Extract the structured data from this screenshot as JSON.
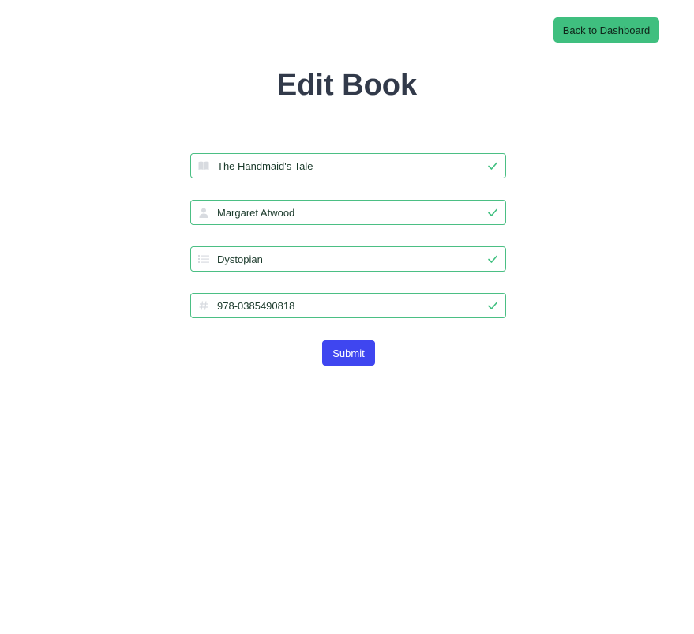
{
  "header": {
    "back_label": "Back to Dashboard",
    "title": "Edit Book"
  },
  "form": {
    "title_value": "The Handmaid's Tale",
    "author_value": "Margaret Atwood",
    "genre_value": "Dystopian",
    "isbn_value": "978-0385490818",
    "submit_label": "Submit"
  },
  "icons": {
    "title_field": "book-icon",
    "author_field": "user-icon",
    "genre_field": "list-icon",
    "isbn_field": "hash-icon",
    "valid": "check-icon"
  },
  "colors": {
    "back_button": "#3fbf7f",
    "valid_border": "#4bbf84",
    "submit_button": "#3f46f0",
    "title_text": "#323a4a"
  }
}
